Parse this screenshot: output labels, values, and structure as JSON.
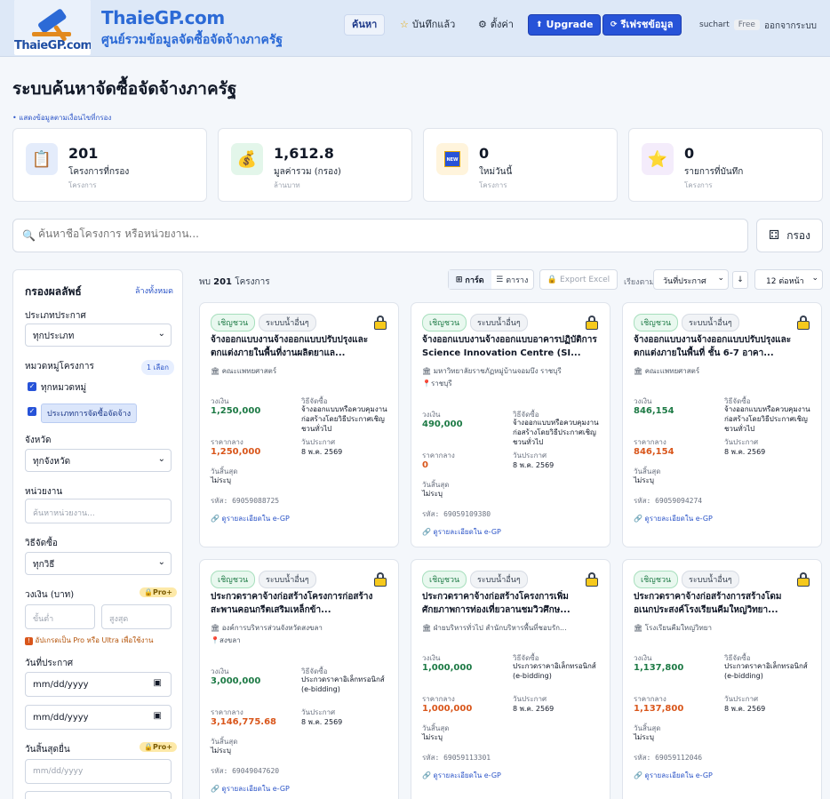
{
  "header": {
    "logo_text": "ThaieGP.com",
    "brand": "ThaieGP.com",
    "brand_sub": "ศูนย์รวมข้อมูลจัดซื้อจัดจ้างภาครัฐ",
    "nav": {
      "search": "ค้นหา",
      "saved": "บันทึกแล้ว",
      "settings": "ตั้งค่า",
      "upgrade": "Upgrade",
      "refresh": "รีเฟรชข้อมูล"
    },
    "user": "suchart",
    "plan": "Free",
    "logout": "ออกจากระบบ"
  },
  "page": {
    "title": "ระบบค้นหาจัดซื้อจัดจ้างภาครัฐ",
    "note": "• แสดงข้อมูลตามเงื่อนไขที่กรอง"
  },
  "stats": [
    {
      "value": "201",
      "label": "โครงการที่กรอง",
      "unit": "โครงการ",
      "icon": "clipboard-icon",
      "color": "#e4ecfb"
    },
    {
      "value": "1,612.8",
      "label": "มูลค่ารวม (กรอง)",
      "unit": "ล้านบาท",
      "icon": "money-bag-icon",
      "color": "#e3f6ea"
    },
    {
      "value": "0",
      "label": "ใหม่วันนี้",
      "unit": "โครงการ",
      "icon": "new-icon",
      "color": "#fff4dc"
    },
    {
      "value": "0",
      "label": "รายการที่บันทึก",
      "unit": "โครงการ",
      "icon": "star-icon",
      "color": "#f4ecfb"
    }
  ],
  "search": {
    "placeholder": "ค้นหาชื่อโครงการ หรือหน่วยงาน...",
    "filter_button": "กรอง"
  },
  "sidebar": {
    "title": "กรองผลลัพธ์",
    "clear": "ล้างทั้งหมด",
    "announce_type_label": "ประเภทประกาศ",
    "announce_type_value": "ทุกประเภท",
    "category_label": "หมวดหมู่โครงการ",
    "category_count": "1 เลือก",
    "category_all": "ทุกหมวดหมู่",
    "category_chip": "ประเภทการจัดซื้อจัดจ้าง",
    "province_label": "จังหวัด",
    "province_value": "ทุกจังหวัด",
    "agency_label": "หน่วยงาน",
    "agency_placeholder": "ค้นหาหน่วยงาน...",
    "method_label": "วิธีจัดซื้อ",
    "method_value": "ทุกวิธี",
    "budget_label": "วงเงิน (บาท)",
    "pro_label": "Pro+",
    "budget_min": "ขั้นต่ำ",
    "budget_max": "สูงสุด",
    "upgrade_note": "อัปเกรดเป็น Pro หรือ Ultra เพื่อใช้งาน",
    "announce_date_label": "วันที่ประกาศ",
    "date_placeholder": "mm/dd/yyyy",
    "deadline_label": "วันสิ้นสุดยื่น",
    "deadline_placeholder": "mm/dd/yyyy"
  },
  "results": {
    "found_prefix": "พบ",
    "found_count": "201",
    "found_suffix": "โครงการ",
    "view_card": "การ์ด",
    "view_table": "ตาราง",
    "export": "Export Excel",
    "sort_label": "เรียงตาม",
    "sort_value": "วันที่ประกาศ",
    "sort_dir": "↓",
    "per_page": "12 ต่อหน้า"
  },
  "card_labels": {
    "budget": "วงเงิน",
    "method": "วิธีจัดซื้อ",
    "median": "ราคากลาง",
    "announce": "วันประกาศ",
    "deadline": "วันสิ้นสุด",
    "code_prefix": "รหัส:",
    "link": "ดูรายละเอียดใน e-GP"
  },
  "cards": [
    {
      "tag1": "เชิญชวน",
      "tag2": "ระบบน้ำอื่นๆ",
      "title": "จ้างออกแบบงานจ้างออกแบบปรับปรุงและตกแต่งภายในพื้นที่งานผลิตยาแล...",
      "org": "คณะแพทยศาสตร์",
      "province": "",
      "budget": "1,250,000",
      "method": "จ้างออกแบบหรือควบคุมงานก่อสร้างโดยวิธีประกาศเชิญชวนทั่วไป",
      "median": "1,250,000",
      "announce": "8 พ.ค. 2569",
      "deadline": "ไม่ระบุ",
      "code": "69059088725"
    },
    {
      "tag1": "เชิญชวน",
      "tag2": "ระบบน้ำอื่นๆ",
      "title": "จ้างออกแบบงานจ้างออกแบบอาคารปฏิบัติการ Science Innovation Centre (SI...",
      "org": "มหาวิทยาลัยราชภัฏหมู่บ้านจอมบึง ราชบุรี",
      "province": "ราชบุรี",
      "budget": "490,000",
      "method": "จ้างออกแบบหรือควบคุมงานก่อสร้างโดยวิธีประกาศเชิญชวนทั่วไป",
      "median": "0",
      "announce": "8 พ.ค. 2569",
      "deadline": "ไม่ระบุ",
      "code": "69059109380"
    },
    {
      "tag1": "เชิญชวน",
      "tag2": "ระบบน้ำอื่นๆ",
      "title": "จ้างออกแบบงานจ้างออกแบบปรับปรุงและตกแต่งภายในพื้นที่ ชั้น 6-7 อาคา...",
      "org": "คณะแพทยศาสตร์",
      "province": "",
      "budget": "846,154",
      "method": "จ้างออกแบบหรือควบคุมงานก่อสร้างโดยวิธีประกาศเชิญชวนทั่วไป",
      "median": "846,154",
      "announce": "8 พ.ค. 2569",
      "deadline": "ไม่ระบุ",
      "code": "69059094274"
    },
    {
      "tag1": "เชิญชวน",
      "tag2": "ระบบน้ำอื่นๆ",
      "title": "ประกวดราคาจ้างก่อสร้างโครงการก่อสร้างสะพานคอนกรีตเสริมเหล็กข้า...",
      "org": "องค์การบริหารส่วนจังหวัดสงขลา",
      "province": "สงขลา",
      "budget": "3,000,000",
      "method": "ประกวดราคาอิเล็กทรอนิกส์ (e-bidding)",
      "median": "3,146,775.68",
      "announce": "8 พ.ค. 2569",
      "deadline": "ไม่ระบุ",
      "code": "69049047620"
    },
    {
      "tag1": "เชิญชวน",
      "tag2": "ระบบน้ำอื่นๆ",
      "title": "ประกวดราคาจ้างก่อสร้างโครงการเพิ่มศักยภาพการท่องเที่ยวลานชมวิวศึกษ...",
      "org": "ฝ่ายบริหารทั่วไป สำนักบริหารพื้นที่ชอบรัก...",
      "province": "",
      "budget": "1,000,000",
      "method": "ประกวดราคาอิเล็กทรอนิกส์ (e-bidding)",
      "median": "1,000,000",
      "announce": "8 พ.ค. 2569",
      "deadline": "ไม่ระบุ",
      "code": "69059113301"
    },
    {
      "tag1": "เชิญชวน",
      "tag2": "ระบบน้ำอื่นๆ",
      "title": "ประกวดราคาจ้างก่อสร้างการสร้างโดมอเนกประสงค์โรงเรียนคีมใหญ่วิทยา...",
      "org": "โรงเรียนคีมใหญ่วิทยา",
      "province": "",
      "budget": "1,137,800",
      "method": "ประกวดราคาอิเล็กทรอนิกส์ (e-bidding)",
      "median": "1,137,800",
      "announce": "8 พ.ค. 2569",
      "deadline": "ไม่ระบุ",
      "code": "69059112046"
    }
  ]
}
